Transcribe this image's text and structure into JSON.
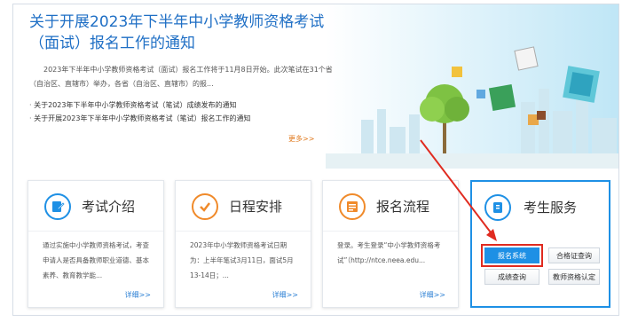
{
  "notice": {
    "headline": "关于开展2023年下半年中小学教师资格考试（面试）报名工作的通知",
    "summary": "2023年下半年中小学教师资格考试（面试）报名工作将于11月8日开始。此次笔试在31个省（自治区、直辖市）举办，各省（自治区、直辖市）的报...",
    "links": [
      "关于2023年下半年中小学教师资格考试（笔试）成绩发布的通知",
      "关于开展2023年下半年中小学教师资格考试（笔试）报名工作的通知"
    ],
    "more": "更多>>"
  },
  "cards": [
    {
      "title": "考试介绍",
      "icon": "edit-document-icon",
      "desc": "通过实施中小学教师资格考试，考查申请人是否具备教师职业道德、基本素养、教育教学能...",
      "detail": "详细>>",
      "accent": "#1e90e5"
    },
    {
      "title": "日程安排",
      "icon": "checkmark-icon",
      "desc": "2023年中小学教师资格考试日期为：上半年笔试3月11日，面试5月13-14日；...",
      "detail": "详细>>",
      "accent": "#f08a2a"
    },
    {
      "title": "报名流程",
      "icon": "form-icon",
      "desc": "登录。考生登录“中小学教师资格考试”（http://ntce.neea.edu...",
      "detail": "详细>>",
      "accent": "#f08a2a"
    }
  ],
  "services": {
    "title": "考生服务",
    "icon": "document-icon",
    "buttons": {
      "register": "报名系统",
      "certificate": "合格证查询",
      "score": "成绩查询",
      "qualification": "教师资格认定"
    }
  },
  "colors": {
    "primary": "#1e90e5",
    "headline": "#1f6fc5",
    "orange": "#f08a2a",
    "highlight": "#e02b20"
  }
}
